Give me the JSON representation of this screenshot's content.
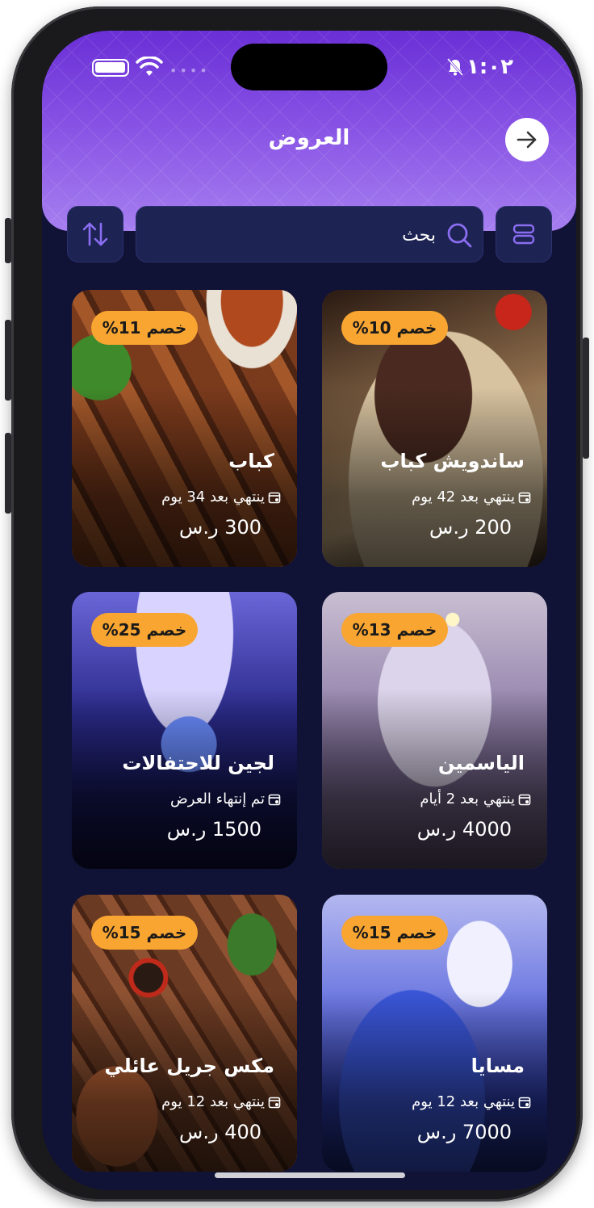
{
  "status_bar": {
    "time": "١:٠٢"
  },
  "header": {
    "title": "العروض"
  },
  "toolbar": {
    "search_placeholder": "بحث"
  },
  "offers": [
    {
      "discount": "خصم 10%",
      "name": "ساندويش كباب",
      "ends": "ينتهي بعد 42 يوم",
      "price": "200 ر.س"
    },
    {
      "discount": "خصم 11%",
      "name": "كباب",
      "ends": "ينتهي بعد 34 يوم",
      "price": "300 ر.س"
    },
    {
      "discount": "خصم 13%",
      "name": "الياسمين",
      "ends": "ينتهي بعد 2 أيام",
      "price": "4000 ر.س"
    },
    {
      "discount": "خصم 25%",
      "name": "لجين للاحتفالات",
      "ends": "تم إنتهاء العرض",
      "price": "1500 ر.س"
    },
    {
      "discount": "خصم 15%",
      "name": "مسايا",
      "ends": "ينتهي بعد 12 يوم",
      "price": "7000 ر.س"
    },
    {
      "discount": "خصم 15%",
      "name": "مكس جريل عائلي",
      "ends": "ينتهي بعد 12 يوم",
      "price": "400 ر.س"
    }
  ],
  "colors": {
    "header_top": "#6a2fd6",
    "header_bottom": "#a67ff0",
    "background": "#101236",
    "badge": "#f9a531",
    "control_bg": "#1d2352"
  },
  "icons": {
    "back": "arrow-right-icon",
    "sort": "sort-arrows-icon",
    "search": "search-icon",
    "layout": "list-layout-icon",
    "calendar": "calendar-icon"
  }
}
